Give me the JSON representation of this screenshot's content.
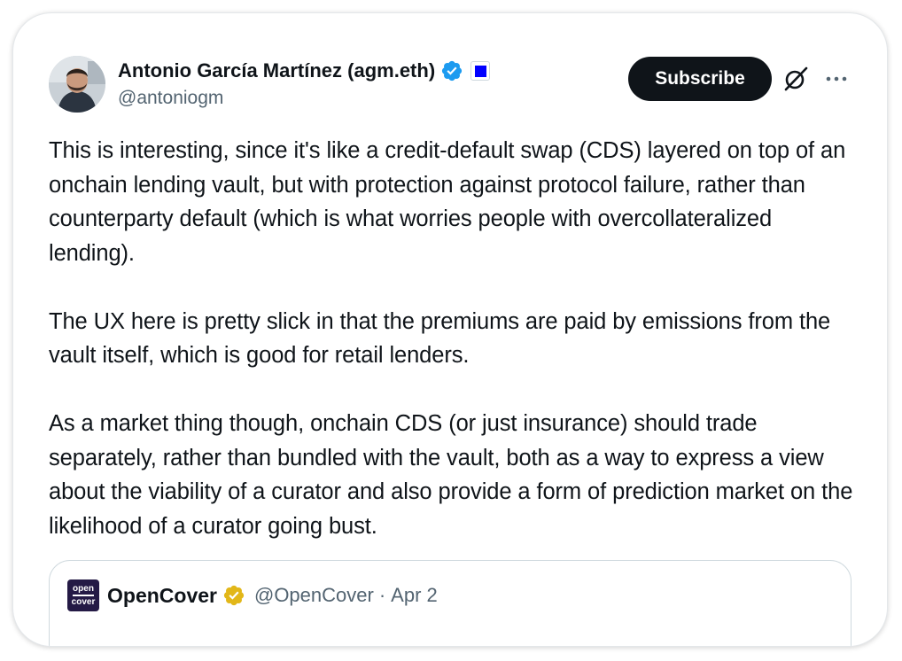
{
  "author": {
    "display_name": "Antonio García Martínez (agm.eth)",
    "handle": "@antoniogm",
    "verified_icon": "blue-verified-badge",
    "affiliation_icon": "blue-square-badge"
  },
  "actions": {
    "subscribe_label": "Subscribe",
    "grok_icon": "grok-icon",
    "more_icon": "more-icon"
  },
  "post": {
    "paragraphs": [
      "This is interesting, since it's like a credit-default swap (CDS) layered on top of an onchain lending vault, but with protection against protocol failure, rather than counterparty default (which is what worries people with overcollateralized lending).",
      "The UX here is pretty slick in that the premiums are paid by emissions from the vault itself, which is good for retail lenders.",
      "As a market thing though, onchain CDS (or just insurance) should trade separately, rather than bundled with the vault, both as a way to express a view about the viability of a curator and also provide a form of prediction market on the likelihood of a curator going bust."
    ]
  },
  "quoted_post": {
    "logo_text_top": "open",
    "logo_text_bottom": "cover",
    "display_name": "OpenCover",
    "verified_icon": "gold-verified-badge",
    "handle": "@OpenCover",
    "separator": "·",
    "date": "Apr 2"
  },
  "colors": {
    "text_primary": "#0f1419",
    "text_secondary": "#536471",
    "verified_blue": "#1d9bf0",
    "verified_gold": "#e2b719",
    "affiliation_blue": "#0000ff",
    "subscribe_bg": "#0f1419",
    "opencover_bg": "#241a45"
  }
}
